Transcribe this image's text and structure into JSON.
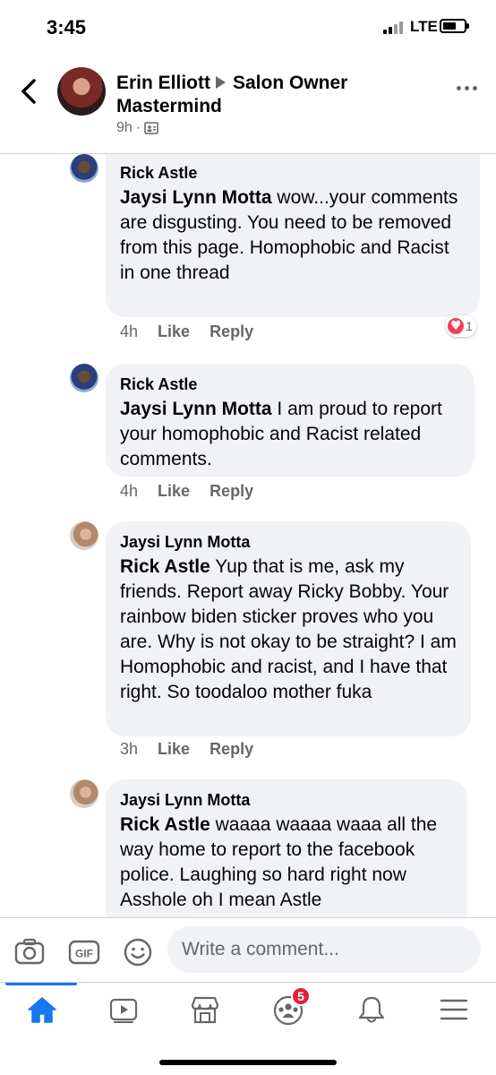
{
  "status_bar": {
    "time": "3:45",
    "network": "LTE"
  },
  "header": {
    "author": "Erin Elliott",
    "group": "Salon Owner Mastermind",
    "meta_time": "9h",
    "privacy_icon": "members-icon"
  },
  "comments": [
    {
      "author": "Rick Astle",
      "mention": "Jaysi Lynn Motta",
      "text": " wow...your comments are disgusting. You need to be removed from this page. Homophobic and Racist in one thread",
      "time": "4h",
      "like": "Like",
      "reply": "Reply",
      "reaction_count": "1",
      "reaction_type": "heart-icon"
    },
    {
      "author": "Rick Astle",
      "mention": "Jaysi Lynn Motta",
      "text": " I am proud to report your homophobic and Racist related comments.",
      "time": "4h",
      "like": "Like",
      "reply": "Reply"
    },
    {
      "author": "Jaysi Lynn Motta",
      "mention": "Rick Astle",
      "text": " Yup that is me, ask my friends. Report away Ricky Bobby. Your rainbow biden sticker proves who you are. Why is not okay to be straight? I am Homophobic and racist, and I have that right. So toodaloo mother fuka",
      "time": "3h",
      "like": "Like",
      "reply": "Reply"
    },
    {
      "author": "Jaysi Lynn Motta",
      "mention": "Rick Astle",
      "text": " waaaa waaaa waaa all the way home to report to the facebook police. Laughing so hard right now Asshole oh I mean Astle"
    }
  ],
  "composer": {
    "placeholder": "Write a comment...",
    "icons": [
      "camera-icon",
      "gif-icon",
      "emoji-icon"
    ]
  },
  "tabbar": {
    "tabs": [
      "home-icon",
      "watch-icon",
      "marketplace-icon",
      "groups-icon",
      "notifications-icon",
      "menu-icon"
    ],
    "active": "home-icon",
    "groups_badge": "5"
  },
  "colors": {
    "accent": "#1877f2",
    "bubble": "#f0f2f5",
    "secondary_text": "#65676b",
    "badge": "#e41e3f",
    "heart": "#f33e58"
  }
}
